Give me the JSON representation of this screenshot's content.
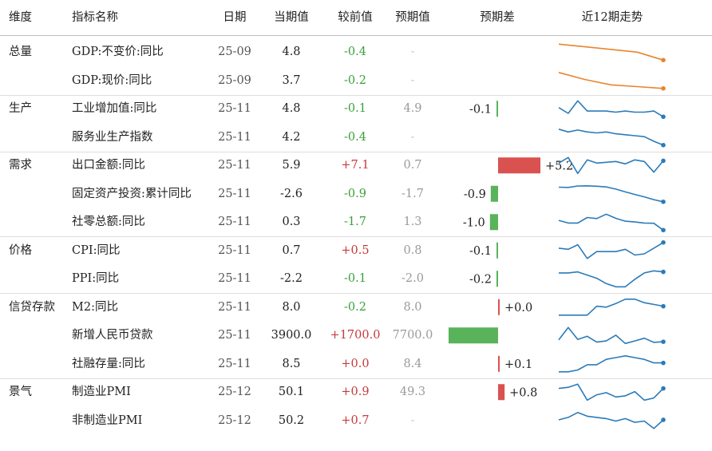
{
  "header": {
    "dim": "维度",
    "name": "指标名称",
    "date": "日期",
    "current": "当期值",
    "change": "较前值",
    "expected": "预期值",
    "diff": "预期差",
    "trend": "近12期走势"
  },
  "groups": [
    {
      "label": "总量",
      "rows": [
        0,
        1
      ]
    },
    {
      "label": "生产",
      "rows": [
        2,
        3
      ]
    },
    {
      "label": "需求",
      "rows": [
        4,
        5,
        6
      ]
    },
    {
      "label": "价格",
      "rows": [
        7,
        8
      ]
    },
    {
      "label": "信贷存款",
      "rows": [
        9,
        10,
        11
      ]
    },
    {
      "label": "景气",
      "rows": [
        12,
        13
      ]
    }
  ],
  "rows": [
    {
      "name": "GDP:不变价:同比",
      "date": "25-09",
      "current": "4.8",
      "change": "-0.4",
      "expected": "-"
    },
    {
      "name": "GDP:现价:同比",
      "date": "25-09",
      "current": "3.7",
      "change": "-0.2",
      "expected": "-"
    },
    {
      "name": "工业增加值:同比",
      "date": "25-11",
      "current": "4.8",
      "change": "-0.1",
      "expected": "4.9"
    },
    {
      "name": "服务业生产指数",
      "date": "25-11",
      "current": "4.2",
      "change": "-0.4",
      "expected": "-"
    },
    {
      "name": "出口金额:同比",
      "date": "25-11",
      "current": "5.9",
      "change": "+7.1",
      "expected": "0.7"
    },
    {
      "name": "固定资产投资:累计同比",
      "date": "25-11",
      "current": "-2.6",
      "change": "-0.9",
      "expected": "-1.7"
    },
    {
      "name": "社零总额:同比",
      "date": "25-11",
      "current": "0.3",
      "change": "-1.7",
      "expected": "1.3"
    },
    {
      "name": "CPI:同比",
      "date": "25-11",
      "current": "0.7",
      "change": "+0.5",
      "expected": "0.8"
    },
    {
      "name": "PPI:同比",
      "date": "25-11",
      "current": "-2.2",
      "change": "-0.1",
      "expected": "-2.0"
    },
    {
      "name": "M2:同比",
      "date": "25-11",
      "current": "8.0",
      "change": "-0.2",
      "expected": "8.0"
    },
    {
      "name": "新增人民币贷款",
      "date": "25-11",
      "current": "3900.0",
      "change": "+1700.0",
      "expected": "7700.0"
    },
    {
      "name": "社融存量:同比",
      "date": "25-11",
      "current": "8.5",
      "change": "+0.0",
      "expected": "8.4"
    },
    {
      "name": "制造业PMI",
      "date": "25-12",
      "current": "50.1",
      "change": "+0.9",
      "expected": "49.3"
    },
    {
      "name": "非制造业PMI",
      "date": "25-12",
      "current": "50.2",
      "change": "+0.7",
      "expected": "-"
    }
  ],
  "colors": {
    "positive": "#c8393b",
    "negative": "#3aa03a",
    "bar_positive": "#d9524f",
    "bar_negative": "#59b35a",
    "spark_orange": "#e8852e",
    "spark_blue": "#2b7bb9"
  },
  "chart_data": {
    "type": "table",
    "title": "",
    "diff_bars": {
      "values": [
        null,
        null,
        -0.1,
        null,
        5.2,
        -0.9,
        -1.0,
        -0.1,
        -0.2,
        0.0,
        -3800.0,
        0.1,
        0.8,
        null
      ],
      "labels": [
        "",
        "",
        "-0.1",
        "",
        "+5.2",
        "-0.9",
        "-1.0",
        "-0.1",
        "-0.2",
        "+0.0",
        "",
        "+0.1",
        "+0.8",
        ""
      ]
    },
    "sparklines": [
      {
        "name": "GDP:不变价:同比",
        "color": "orange",
        "values": [
          5.4,
          5.3,
          5.2,
          5.1,
          4.8
        ]
      },
      {
        "name": "GDP:现价:同比",
        "color": "orange",
        "values": [
          4.6,
          4.2,
          3.9,
          3.8,
          3.7
        ]
      },
      {
        "name": "工业增加值:同比",
        "color": "blue",
        "values": [
          5.6,
          5.1,
          6.2,
          5.3,
          5.3,
          5.3,
          5.2,
          5.3,
          5.2,
          5.2,
          5.3,
          4.8
        ]
      },
      {
        "name": "服务业生产指数",
        "color": "blue",
        "values": [
          5.9,
          5.6,
          5.8,
          5.6,
          5.5,
          5.6,
          5.4,
          5.3,
          5.2,
          5.1,
          4.6,
          4.2
        ]
      },
      {
        "name": "出口金额:同比",
        "color": "blue",
        "values": [
          4.5,
          8.0,
          -2.0,
          6.5,
          4.5,
          5.0,
          5.5,
          4.0,
          6.5,
          5.5,
          -1.2,
          5.9
        ]
      },
      {
        "name": "固定资产投资:累计同比",
        "color": "blue",
        "values": [
          3.6,
          3.5,
          4.1,
          4.2,
          4.0,
          3.7,
          2.8,
          1.6,
          0.5,
          -0.5,
          -1.7,
          -2.6
        ]
      },
      {
        "name": "社零总额:同比",
        "color": "blue",
        "values": [
          4.0,
          3.0,
          3.0,
          5.1,
          4.7,
          6.4,
          4.8,
          3.7,
          3.4,
          3.0,
          2.9,
          0.3
        ]
      },
      {
        "name": "CPI:同比",
        "color": "blue",
        "values": [
          0.2,
          0.1,
          0.5,
          -0.7,
          -0.1,
          -0.1,
          -0.1,
          0.1,
          -0.4,
          -0.3,
          0.2,
          0.7
        ]
      },
      {
        "name": "PPI:同比",
        "color": "blue",
        "values": [
          -2.3,
          -2.3,
          -2.2,
          -2.5,
          -2.8,
          -3.3,
          -3.6,
          -3.6,
          -2.9,
          -2.3,
          -2.1,
          -2.2
        ]
      },
      {
        "name": "M2:同比",
        "color": "blue",
        "values": [
          7.0,
          7.0,
          7.0,
          7.0,
          8.0,
          7.9,
          8.3,
          8.8,
          8.8,
          8.4,
          8.2,
          8.0
        ]
      },
      {
        "name": "新增人民币贷款",
        "color": "blue",
        "values": [
          9000,
          41000,
          10000,
          18000,
          3000,
          6000,
          21000,
          -500,
          6000,
          13000,
          2200,
          3900
        ]
      },
      {
        "name": "社融存量:同比",
        "color": "blue",
        "values": [
          8.0,
          8.0,
          8.1,
          8.4,
          8.4,
          8.7,
          8.8,
          8.9,
          8.8,
          8.7,
          8.5,
          8.5
        ]
      },
      {
        "name": "制造业PMI",
        "color": "blue",
        "values": [
          50.1,
          50.2,
          50.5,
          49.0,
          49.5,
          49.7,
          49.3,
          49.4,
          49.8,
          49.0,
          49.2,
          50.1
        ]
      },
      {
        "name": "非制造业PMI",
        "color": "blue",
        "values": [
          50.2,
          50.4,
          50.8,
          50.5,
          50.4,
          50.3,
          50.1,
          50.3,
          50.0,
          50.1,
          49.5,
          50.2
        ]
      }
    ]
  }
}
